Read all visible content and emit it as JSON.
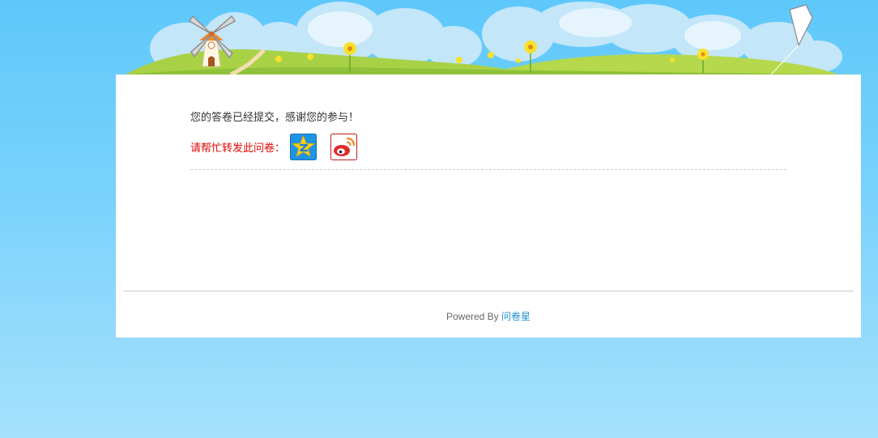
{
  "message": "您的答卷已经提交，感谢您的参与！",
  "share": {
    "label": "请帮忙转发此问卷：",
    "buttons": [
      {
        "name": "qzone-share-button",
        "icon": "qzone-star-icon"
      },
      {
        "name": "weibo-share-button",
        "icon": "weibo-icon"
      }
    ]
  },
  "footer": {
    "powered_prefix": "Powered By ",
    "brand_link": "问卷星"
  },
  "colors": {
    "sky_top": "#5ec8fb",
    "sky_bottom": "#a5e1fd",
    "share_label": "#e10600",
    "link": "#1f8fd8"
  }
}
